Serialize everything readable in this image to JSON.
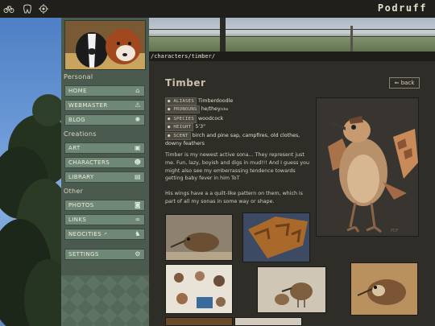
{
  "topbar": {
    "icons": [
      "bike-icon",
      "tooth-icon",
      "target-icon"
    ],
    "brand": "Podruff"
  },
  "sidebar": {
    "sections": [
      {
        "title": "Personal",
        "items": [
          {
            "label": "HOME",
            "icon": "home-icon"
          },
          {
            "label": "WEBMASTER",
            "icon": "warning-icon"
          },
          {
            "label": "BLOG",
            "icon": "sun-icon"
          }
        ]
      },
      {
        "title": "Creations",
        "items": [
          {
            "label": "ART",
            "icon": "image-icon"
          },
          {
            "label": "CHARACTERS",
            "icon": "people-icon"
          },
          {
            "label": "LIBRARY",
            "icon": "book-icon"
          }
        ]
      },
      {
        "title": "Other",
        "items": [
          {
            "label": "PHOTOS",
            "icon": "camera-icon"
          },
          {
            "label": "LINKS",
            "icon": "link-icon"
          },
          {
            "label": "NEOCITIES",
            "icon": "cat-icon"
          }
        ]
      }
    ],
    "settings": {
      "label": "SETTINGS",
      "icon": "gear-icon"
    }
  },
  "path": "/characters/timber/",
  "character": {
    "name": "Timber",
    "back_label": "back",
    "aliases_tag": "ALIASES",
    "aliases": "Timberdoodle",
    "pronouns_tag": "PRONOUNS",
    "pronouns": "he/they",
    "pronouns_note": "/she",
    "species_tag": "SPECIES",
    "species": "woodcock",
    "height_tag": "HEIGHT",
    "height": "5'3\"",
    "scent_tag": "SCENT",
    "scent": "birch and pine sap, campfires, old clothes, downy feathers",
    "paragraph1": "Timber is my newest active sona... They represent just me. Fun, lazy, boyish and digs in mud!!! And I guess you might also see my emberrassing tendence towards getting baby fever in him ToT",
    "paragraph2": "His wings have a a quilt-like pattern on them, which is part of all my sonas in some way or shape."
  },
  "colors": {
    "accent_green": "#6f8776",
    "sidebar_bg": "#4a5a4e",
    "content_bg": "#2f2d28",
    "topbar_bg": "#211f1b"
  }
}
